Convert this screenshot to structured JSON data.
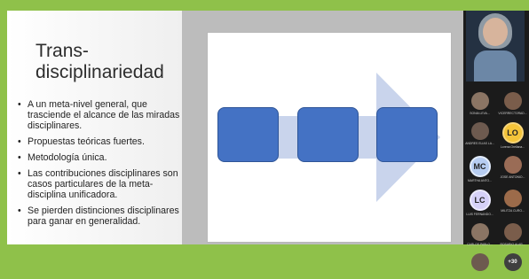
{
  "slide": {
    "title": "Trans-\ndisciplinariedad",
    "bullets": [
      "A un meta-nivel general, que trasciende el alcance de las miradas disciplinares.",
      "Propuestas teóricas fuertes.",
      "Metodología única.",
      "Las contribuciones disciplinares son casos particulares de la meta-disciplina unificadora.",
      "Se pierden distinciones disciplinares para ganar en generalidad."
    ]
  },
  "participants": {
    "rows": [
      [
        {
          "name": "SONIA LEVA...",
          "initials": "",
          "kind": "photo"
        },
        {
          "name": "VICERRECTORAD...",
          "initials": "",
          "kind": "photo"
        }
      ],
      [
        {
          "name": "ANDRES ELIAS LA...",
          "initials": "",
          "kind": "photo"
        },
        {
          "name": "Lorena Orellana...",
          "initials": "LO",
          "kind": "lo"
        }
      ],
      [
        {
          "name": "MARTHA ANTO...",
          "initials": "MC",
          "kind": "mc"
        },
        {
          "name": "JOSE ANTONIO...",
          "initials": "",
          "kind": "photo"
        }
      ],
      [
        {
          "name": "LUIS FERNANDO...",
          "initials": "LC",
          "kind": "lc"
        },
        {
          "name": "MILITZA CURO...",
          "initials": "",
          "kind": "photo"
        }
      ],
      [
        {
          "name": "CARLOS PABLO...",
          "initials": "",
          "kind": "photo"
        },
        {
          "name": "ROSARIO ALAR...",
          "initials": "",
          "kind": "photo"
        }
      ],
      [
        {
          "name": "",
          "initials": "",
          "kind": "photo"
        },
        {
          "name": "",
          "initials": "+30",
          "kind": "more"
        }
      ]
    ]
  },
  "colors": {
    "frame_green": "#8fc14a",
    "slide_gray": "#bcbcbc",
    "box_blue": "#4472c4",
    "arrow_light_blue": "#c9d4ec"
  }
}
